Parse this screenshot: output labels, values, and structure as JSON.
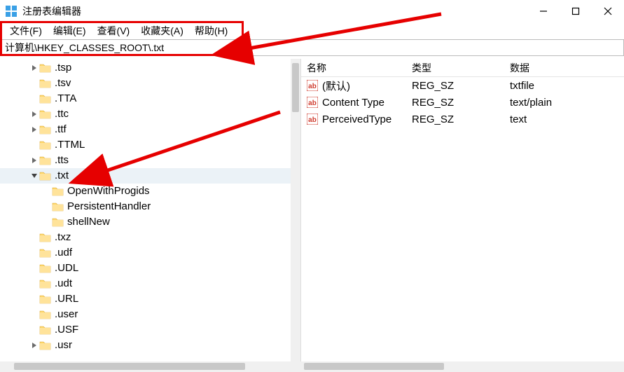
{
  "window": {
    "title": "注册表编辑器"
  },
  "menu": {
    "file": "文件(F)",
    "edit": "编辑(E)",
    "view": "查看(V)",
    "favorites": "收藏夹(A)",
    "help": "帮助(H)"
  },
  "address": {
    "path": "计算机\\HKEY_CLASSES_ROOT\\.txt"
  },
  "tree": [
    {
      "indent": 2,
      "expander": ">",
      "label": ".tsp"
    },
    {
      "indent": 2,
      "expander": "",
      "label": ".tsv"
    },
    {
      "indent": 2,
      "expander": "",
      "label": ".TTA"
    },
    {
      "indent": 2,
      "expander": ">",
      "label": ".ttc"
    },
    {
      "indent": 2,
      "expander": ">",
      "label": ".ttf"
    },
    {
      "indent": 2,
      "expander": "",
      "label": ".TTML"
    },
    {
      "indent": 2,
      "expander": ">",
      "label": ".tts"
    },
    {
      "indent": 2,
      "expander": "v",
      "label": ".txt",
      "selected": true
    },
    {
      "indent": 3,
      "expander": "",
      "label": "OpenWithProgids"
    },
    {
      "indent": 3,
      "expander": "",
      "label": "PersistentHandler"
    },
    {
      "indent": 3,
      "expander": "",
      "label": "shellNew"
    },
    {
      "indent": 2,
      "expander": "",
      "label": ".txz"
    },
    {
      "indent": 2,
      "expander": "",
      "label": ".udf"
    },
    {
      "indent": 2,
      "expander": "",
      "label": ".UDL"
    },
    {
      "indent": 2,
      "expander": "",
      "label": ".udt"
    },
    {
      "indent": 2,
      "expander": "",
      "label": ".URL"
    },
    {
      "indent": 2,
      "expander": "",
      "label": ".user"
    },
    {
      "indent": 2,
      "expander": "",
      "label": ".USF"
    },
    {
      "indent": 2,
      "expander": ">",
      "label": ".usr"
    }
  ],
  "list": {
    "headers": {
      "name": "名称",
      "type": "类型",
      "data": "数据"
    },
    "rows": [
      {
        "name": "(默认)",
        "type": "REG_SZ",
        "data": "txtfile"
      },
      {
        "name": "Content Type",
        "type": "REG_SZ",
        "data": "text/plain"
      },
      {
        "name": "PerceivedType",
        "type": "REG_SZ",
        "data": "text"
      }
    ]
  }
}
